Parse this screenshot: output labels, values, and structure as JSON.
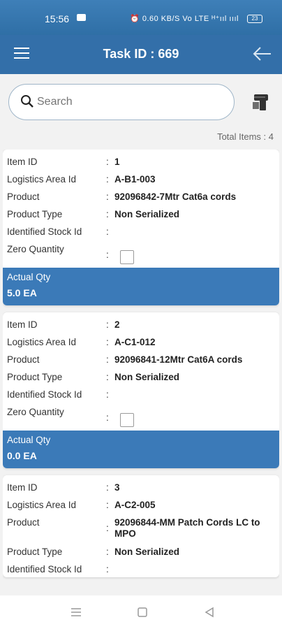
{
  "status_bar": {
    "time": "15:56",
    "indicators": "⏰ 0.60 KB/S Vo LTE ᴴ⁺ııl ıııl",
    "battery": "23"
  },
  "header": {
    "title": "Task ID : 669"
  },
  "search": {
    "placeholder": "Search"
  },
  "summary": {
    "total_items": "Total Items : 4"
  },
  "labels": {
    "item_id": "Item ID",
    "logistics_area": "Logistics Area Id",
    "product": "Product",
    "product_type": "Product Type",
    "identified_stock": "Identified Stock Id",
    "zero_quantity": "Zero Quantity",
    "actual_qty": "Actual Qty",
    "colon": ":"
  },
  "items": [
    {
      "item_id": "1",
      "logistics_area": "A-B1-003",
      "product": "92096842-7Mtr Cat6a cords",
      "product_type": "Non Serialized",
      "identified_stock": "",
      "zero_quantity": false,
      "actual_qty": "5.0 EA"
    },
    {
      "item_id": "2",
      "logistics_area": "A-C1-012",
      "product": "92096841-12Mtr Cat6A cords",
      "product_type": "Non Serialized",
      "identified_stock": "",
      "zero_quantity": false,
      "actual_qty": "0.0 EA"
    },
    {
      "item_id": "3",
      "logistics_area": "A-C2-005",
      "product": "92096844-MM Patch Cords LC to MPO",
      "product_type": "Non Serialized",
      "identified_stock": ""
    }
  ],
  "colors": {
    "primary": "#336fa9",
    "footer": "#3b7ab8"
  }
}
